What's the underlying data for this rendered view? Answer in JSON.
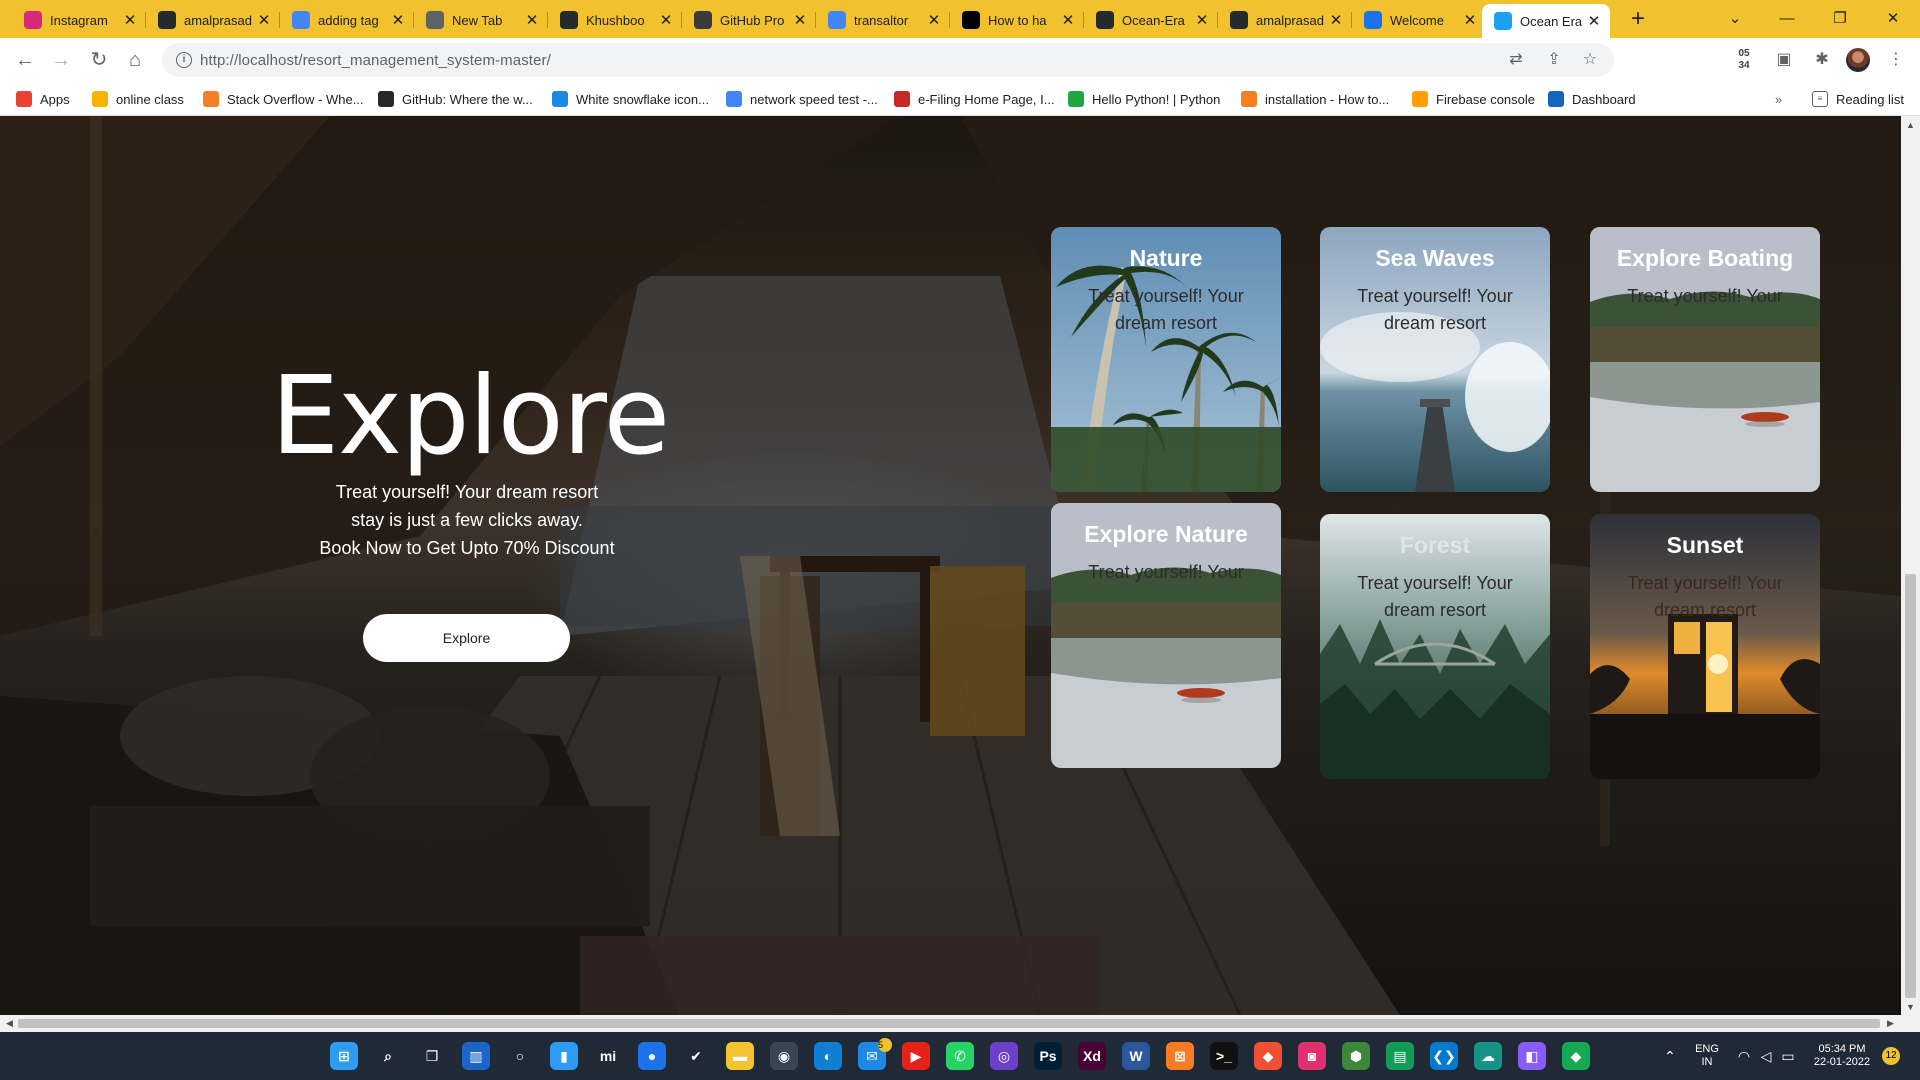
{
  "browser": {
    "tabs": [
      {
        "label": "Instagram",
        "icon": "instagram-icon",
        "color": "#d62976"
      },
      {
        "label": "amalprasad",
        "icon": "github-icon",
        "color": "#24292e"
      },
      {
        "label": "adding tag",
        "icon": "google-icon",
        "color": "#4285f4"
      },
      {
        "label": "New Tab",
        "icon": "chrome-icon",
        "color": "#5f6368"
      },
      {
        "label": "Khushboo",
        "icon": "github-icon",
        "color": "#24292e"
      },
      {
        "label": "GitHub Pro",
        "icon": "mg-icon",
        "color": "#3b3b3b"
      },
      {
        "label": "transaltor",
        "icon": "google-icon",
        "color": "#4285f4"
      },
      {
        "label": "How to ha",
        "icon": "medium-icon",
        "color": "#000000"
      },
      {
        "label": "Ocean-Era",
        "icon": "github-icon",
        "color": "#24292e"
      },
      {
        "label": "amalprasad",
        "icon": "github-icon",
        "color": "#24292e"
      },
      {
        "label": "Welcome",
        "icon": "c-icon",
        "color": "#1a73e8"
      },
      {
        "label": "Ocean Era",
        "icon": "wave-icon",
        "color": "#1ea1f2"
      }
    ],
    "url": "http://localhost/resort_management_system-master/",
    "timer_badge": "05\n34",
    "bookmarks": [
      {
        "label": "Apps",
        "icon": "apps-grid-icon",
        "color": "#ea4335"
      },
      {
        "label": "online class",
        "icon": "classroom-icon",
        "color": "#f4b400"
      },
      {
        "label": "Stack Overflow - Whe...",
        "icon": "stackoverflow-icon",
        "color": "#f48024"
      },
      {
        "label": "GitHub: Where the w...",
        "icon": "github-icon",
        "color": "#24292e"
      },
      {
        "label": "White snowflake icon...",
        "icon": "heart-icon",
        "color": "#1e88e5"
      },
      {
        "label": "network speed test -...",
        "icon": "google-icon",
        "color": "#4285f4"
      },
      {
        "label": "e-Filing Home Page, I...",
        "icon": "efiling-icon",
        "color": "#c62828"
      },
      {
        "label": "Hello Python! | Python",
        "icon": "python-icon",
        "color": "#21a645"
      },
      {
        "label": "installation - How to...",
        "icon": "stackexchange-icon",
        "color": "#f48024"
      },
      {
        "label": "Firebase console",
        "icon": "firebase-icon",
        "color": "#ffa000"
      },
      {
        "label": "Dashboard",
        "icon": "dashboard-icon",
        "color": "#1565c0"
      }
    ],
    "reading_list": "Reading list"
  },
  "hero": {
    "title": "Explore",
    "text_line1": "Treat yourself! Your dream resort",
    "text_line2": "stay is just a few clicks away.",
    "text_line3": "Book Now to Get Upto 70% Discount",
    "button": "Explore"
  },
  "cards": [
    {
      "title": "Nature",
      "desc": "Treat yourself! Your dream resort",
      "scene": "palms"
    },
    {
      "title": "Sea Waves",
      "desc": "Treat yourself! Your dream resort",
      "scene": "waves"
    },
    {
      "title": "Explore Boating",
      "desc": "Treat yourself! Your",
      "scene": "lake"
    },
    {
      "title": "Explore Nature",
      "desc": "Treat yourself! Your",
      "scene": "lake"
    },
    {
      "title": "Forest",
      "desc": "Treat yourself! Your dream resort",
      "scene": "forest"
    },
    {
      "title": "Sunset",
      "desc": "Treat yourself! Your dream resort",
      "scene": "sunset"
    }
  ],
  "taskbar": {
    "icons": [
      {
        "name": "windows-start-icon",
        "color": "#2f9cf4",
        "glyph": "⊞"
      },
      {
        "name": "search-icon",
        "color": "transparent",
        "glyph": "⌕"
      },
      {
        "name": "task-view-icon",
        "color": "transparent",
        "glyph": "❐"
      },
      {
        "name": "widgets-icon",
        "color": "#1c64c8",
        "glyph": "▥"
      },
      {
        "name": "cortana-icon",
        "color": "transparent",
        "glyph": "○"
      },
      {
        "name": "notepad-icon",
        "color": "#2f9cf4",
        "glyph": "▮"
      },
      {
        "name": "mi-icon",
        "color": "transparent",
        "glyph": "mi"
      },
      {
        "name": "browser-icon",
        "color": "#1a73e8",
        "glyph": "●"
      },
      {
        "name": "todo-icon",
        "color": "transparent",
        "glyph": "✔"
      },
      {
        "name": "file-explorer-icon",
        "color": "#f4c430",
        "glyph": "▬"
      },
      {
        "name": "chrome-icon",
        "color": "#3a4654",
        "glyph": "◉"
      },
      {
        "name": "edge-icon",
        "color": "#0f7fd4",
        "glyph": "◐"
      },
      {
        "name": "mail-icon",
        "color": "#1e88e5",
        "glyph": "✉",
        "badge": "5"
      },
      {
        "name": "youtube-icon",
        "color": "#e62117",
        "glyph": "▶"
      },
      {
        "name": "whatsapp-icon",
        "color": "#25d366",
        "glyph": "✆"
      },
      {
        "name": "github-desktop-icon",
        "color": "#6e40c9",
        "glyph": "◎"
      },
      {
        "name": "photoshop-icon",
        "color": "#001e36",
        "glyph": "Ps"
      },
      {
        "name": "adobe-xd-icon",
        "color": "#470137",
        "glyph": "Xd"
      },
      {
        "name": "word-icon",
        "color": "#2b579a",
        "glyph": "W"
      },
      {
        "name": "xampp-icon",
        "color": "#fb7a24",
        "glyph": "⊠"
      },
      {
        "name": "terminal-icon",
        "color": "#111111",
        "glyph": ">_"
      },
      {
        "name": "git-icon",
        "color": "#f05032",
        "glyph": "◆"
      },
      {
        "name": "camera-icon",
        "color": "#e1306c",
        "glyph": "◙"
      },
      {
        "name": "node-icon",
        "color": "#3c873a",
        "glyph": "⬢"
      },
      {
        "name": "sheets-icon",
        "color": "#0f9d58",
        "glyph": "▤"
      },
      {
        "name": "vscode-icon",
        "color": "#007acc",
        "glyph": "❮❯"
      },
      {
        "name": "gitkraken-icon",
        "color": "#179287",
        "glyph": "☁"
      },
      {
        "name": "figma-icon",
        "color": "#8a5cf6",
        "glyph": "◧"
      },
      {
        "name": "mongodb-icon",
        "color": "#13aa52",
        "glyph": "◆"
      }
    ],
    "lang_line1": "ENG",
    "lang_line2": "IN",
    "time": "05:34 PM",
    "date": "22-01-2022",
    "notifications": "12"
  }
}
